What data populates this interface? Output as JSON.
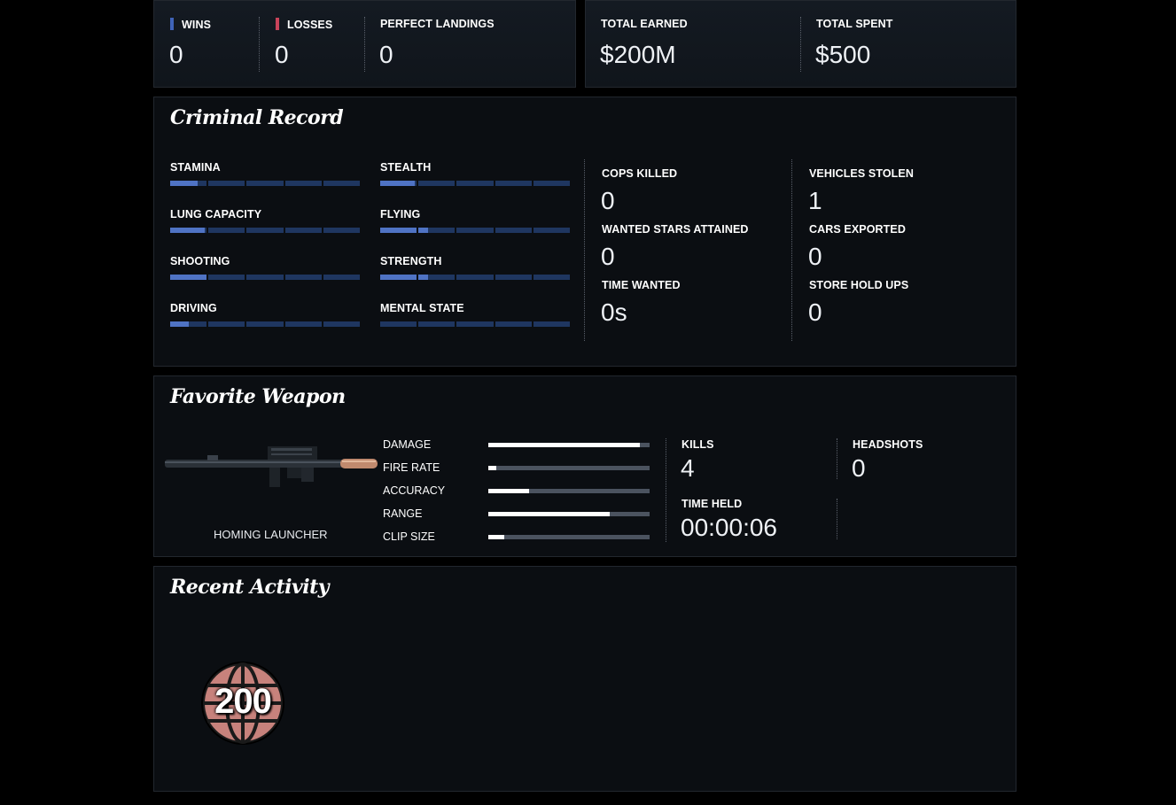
{
  "summary": {
    "wins_label": "WINS",
    "wins_value": "0",
    "losses_label": "LOSSES",
    "losses_value": "0",
    "landings_label": "PERFECT LANDINGS",
    "landings_value": "0",
    "earned_label": "TOTAL EARNED",
    "earned_value": "$200M",
    "spent_label": "TOTAL SPENT",
    "spent_value": "$500",
    "wins_color": "#3f63b8",
    "losses_color": "#c9435a"
  },
  "criminal_record": {
    "title": "Criminal Record",
    "skills": [
      {
        "label": "STAMINA",
        "level": 0.15
      },
      {
        "label": "STEALTH",
        "level": 0.19
      },
      {
        "label": "LUNG CAPACITY",
        "level": 0.19
      },
      {
        "label": "FLYING",
        "level": 0.25
      },
      {
        "label": "SHOOTING",
        "level": 0.2
      },
      {
        "label": "STRENGTH",
        "level": 0.25
      },
      {
        "label": "DRIVING",
        "level": 0.1
      },
      {
        "label": "MENTAL STATE",
        "level": 0.0
      }
    ],
    "stats": {
      "cops_killed_label": "COPS KILLED",
      "cops_killed_value": "0",
      "wanted_stars_label": "WANTED STARS ATTAINED",
      "wanted_stars_value": "0",
      "time_wanted_label": "TIME WANTED",
      "time_wanted_value": "0s",
      "vehicles_stolen_label": "VEHICLES STOLEN",
      "vehicles_stolen_value": "1",
      "cars_exported_label": "CARS EXPORTED",
      "cars_exported_value": "0",
      "store_holdups_label": "STORE HOLD UPS",
      "store_holdups_value": "0"
    },
    "bar_empty_color": "#1f3660",
    "bar_fill_color": "#4f73c4"
  },
  "favorite_weapon": {
    "title": "Favorite Weapon",
    "weapon_name": "HOMING LAUNCHER",
    "attributes": [
      {
        "label": "DAMAGE",
        "level": 0.94
      },
      {
        "label": "FIRE RATE",
        "level": 0.05
      },
      {
        "label": "ACCURACY",
        "level": 0.25
      },
      {
        "label": "RANGE",
        "level": 0.75
      },
      {
        "label": "CLIP SIZE",
        "level": 0.1
      }
    ],
    "kills_label": "KILLS",
    "kills_value": "4",
    "headshots_label": "HEADSHOTS",
    "headshots_value": "0",
    "time_held_label": "TIME HELD",
    "time_held_value": "00:00:06"
  },
  "recent_activity": {
    "title": "Recent Activity",
    "badge_value": "200",
    "badge_color": "#c7827c"
  }
}
